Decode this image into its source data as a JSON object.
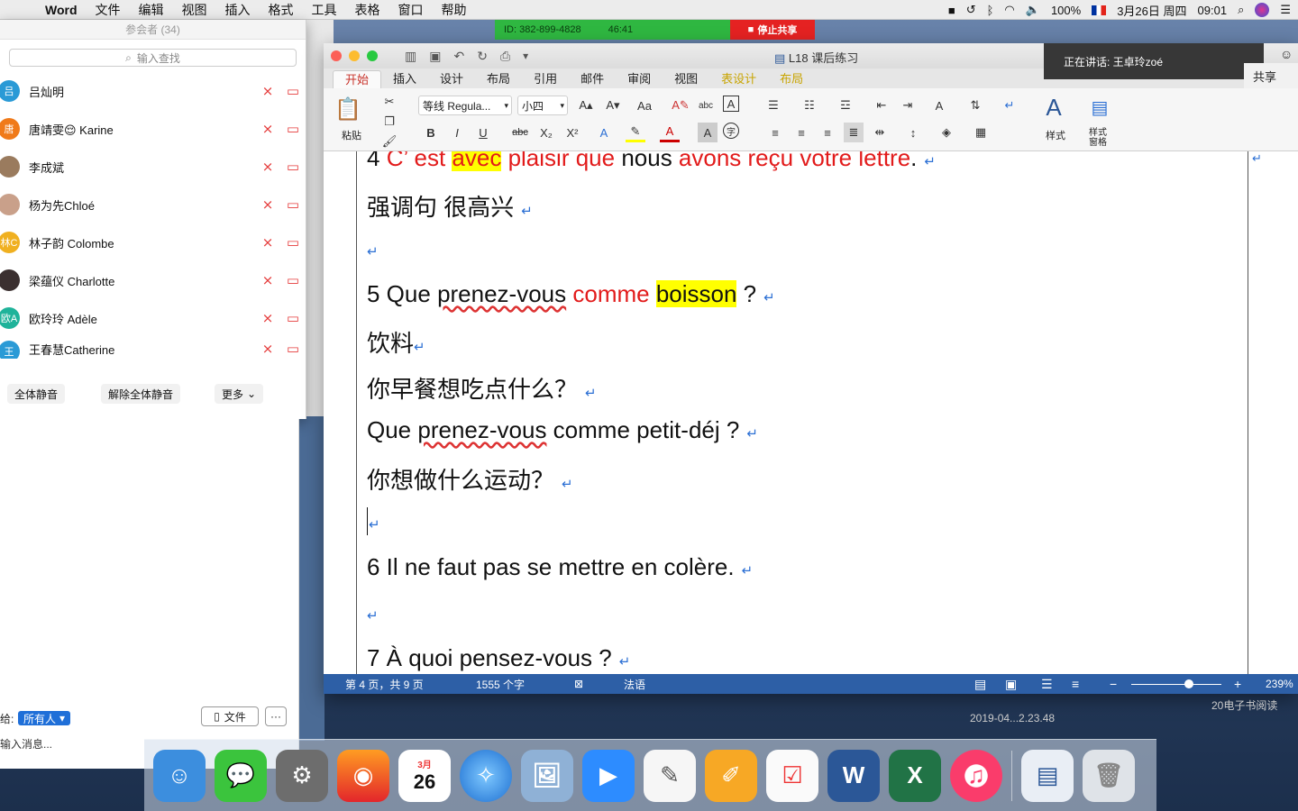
{
  "menubar": {
    "app": "Word",
    "items": [
      "文件",
      "编辑",
      "视图",
      "插入",
      "格式",
      "工具",
      "表格",
      "窗口",
      "帮助"
    ],
    "status": {
      "battery": "100%",
      "date": "3月26日 周四",
      "time": "09:01"
    }
  },
  "zoom_bar": {
    "meeting_id": "ID: 382-899-4828",
    "timer": "46:41",
    "stop_share": "停止共享"
  },
  "participants": {
    "title": "参会者 (34)",
    "search_placeholder": "输入查找",
    "list": [
      {
        "initial": "吕",
        "name": "吕灿明",
        "color": "#2a9ad6"
      },
      {
        "initial": "唐",
        "name": "唐靖雯😌 Karine",
        "color": "#f07a1a"
      },
      {
        "initial": "",
        "name": "李成斌",
        "color": "#9a7b5e"
      },
      {
        "initial": "",
        "name": "杨为先Chloé",
        "color": "#c9a08a"
      },
      {
        "initial": "林C",
        "name": "林子韵 Colombe",
        "color": "#f0b020"
      },
      {
        "initial": "",
        "name": "梁蕴仪 Charlotte",
        "color": "#3b3030"
      },
      {
        "initial": "欧A",
        "name": "欧玲玲  Adèle",
        "color": "#1fb39a"
      },
      {
        "initial": "王",
        "name": "王春慧Catherine",
        "color": "#2a9ad6"
      }
    ],
    "mute_all": "全体静音",
    "unmute_all": "解除全体静音",
    "more": "更多"
  },
  "chat": {
    "to_label": "给:",
    "to_value": "所有人",
    "file_btn": "文件",
    "more_btn": "···",
    "input_placeholder": "输入消息..."
  },
  "word": {
    "doc_title": "L18 课后练习",
    "tabs": [
      "开始",
      "插入",
      "设计",
      "布局",
      "引用",
      "邮件",
      "审阅",
      "视图",
      "表设计",
      "布局"
    ],
    "font": "等线 Regula...",
    "size": "小四",
    "paste": "粘贴",
    "styles": "样式",
    "styles_pane": "样式\n窗格",
    "status": {
      "page": "第 4 页，共 9 页",
      "words": "1555 个字",
      "lang": "法语",
      "zoom": "239%"
    },
    "lines": {
      "l4a": "4 ",
      "l4b": "C’   ",
      "l4c": "est ",
      "l4d": "avec",
      "l4e": " plaisir que ",
      "l4f": "nous ",
      "l4g": "avons reçu votre lettre",
      ".": ".",
      "l_qiang": "强调句  很高兴",
      "l5a": "5 Que ",
      "l5b": "prenez-vous",
      "l5c": " comme ",
      "l5d": "boisson",
      "l5e": " ?",
      "l_yin": "饮料",
      "l_zao": "你早餐想吃点什么？",
      "l_que1": "Que ",
      "l_que2": "prenez-vous",
      "l_que3": " comme petit-déj ?",
      "l_yd": "你想做什么运动？",
      "l6": "6 Il ne faut pas se mettre en colère.",
      "l7": "7 À quoi pensez-vous ?"
    }
  },
  "speaker": "正在讲话: 王卓玲zoé",
  "share_pill": "共享",
  "desktop": {
    "label1": "2019-04...2.23.48",
    "label2": "20电子书阅读",
    "cal_month": "3月",
    "cal_day": "26"
  }
}
